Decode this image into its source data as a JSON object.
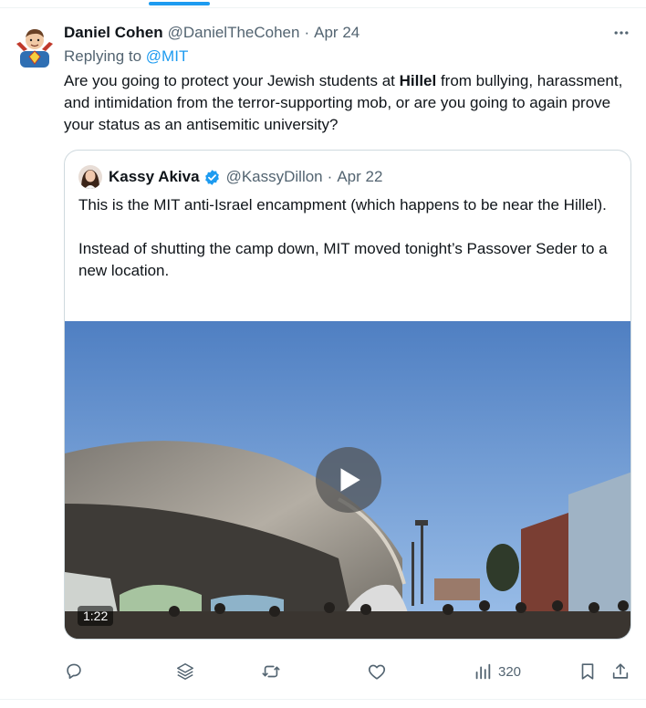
{
  "tweet": {
    "author_name": "Daniel Cohen",
    "author_handle": "@DanielTheCohen",
    "separator": "·",
    "date": "Apr 24",
    "replying_prefix": "Replying to",
    "replying_to": "@MIT",
    "text_before": "Are you going to protect your Jewish students at ",
    "text_bold": "Hillel",
    "text_after": " from bullying, harassment, and intimidation from the terror-supporting mob, or are you going to again prove your status as an antisemitic university?",
    "more_icon": "more-dots-icon"
  },
  "quote": {
    "author_name": "Kassy Akiva",
    "verified_icon": "verified-badge-icon",
    "author_handle": "@KassyDillon",
    "separator": "·",
    "date": "Apr 22",
    "paragraph1": "This is the MIT anti-Israel encampment (which happens to be near the Hillel).",
    "paragraph2": "Instead of shutting the camp down, MIT moved tonight’s Passover Seder to a new location.",
    "video_duration": "1:22",
    "play_icon": "play-icon"
  },
  "actions": {
    "reply_icon": "reply-icon",
    "grok_icon": "layers-icon",
    "retweet_icon": "retweet-icon",
    "like_icon": "heart-icon",
    "views_icon": "views-icon",
    "views_count": "320",
    "bookmark_icon": "bookmark-icon",
    "share_icon": "share-icon"
  },
  "colors": {
    "accent": "#1d9bf0",
    "text": "#0f1419",
    "muted": "#536471",
    "border": "#cfd9de"
  }
}
